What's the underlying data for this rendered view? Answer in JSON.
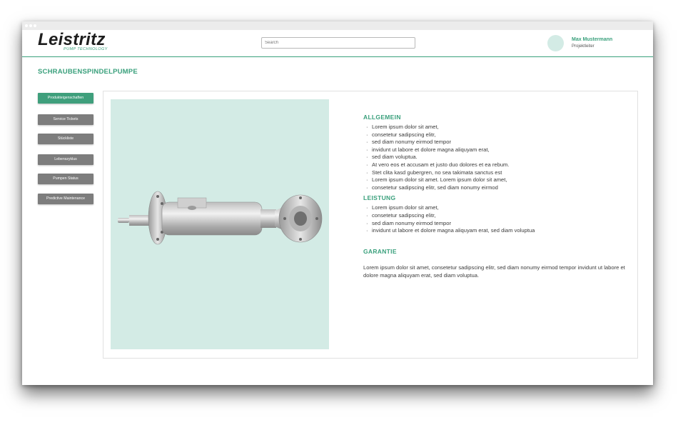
{
  "brand": {
    "name": "Leistritz",
    "tagline": "PUMP TECHNOLOGY",
    "accent": "#3aa07c",
    "image_bg": "#d3ebe5"
  },
  "search": {
    "placeholder": "Search"
  },
  "user": {
    "name": "Max Mustermann",
    "role": "Projektleiter"
  },
  "page": {
    "title": "SCHRAUBENSPINDELPUMPE"
  },
  "nav": {
    "items": [
      {
        "label": "Produkteigenschaften",
        "active": true
      },
      {
        "label": "Service Tickets",
        "active": false
      },
      {
        "label": "Stückliste",
        "active": false
      },
      {
        "label": "Lebenszyklus",
        "active": false
      },
      {
        "label": "Pumpen Status",
        "active": false
      },
      {
        "label": "Predictive Maintenance",
        "active": false
      }
    ]
  },
  "product": {
    "image_icon": "screw-spindle-pump-image"
  },
  "sections": {
    "allgemein": {
      "title": "ALLGEMEIN",
      "items": [
        "Lorem ipsum dolor sit amet,",
        "consetetur sadipscing elitr,",
        "sed diam nonumy eirmod tempor",
        "invidunt ut labore et dolore magna aliquyam erat,",
        "sed diam voluptua.",
        "At vero eos et accusam et justo duo dolores et ea rebum.",
        "Stet clita kasd gubergren, no sea takimata sanctus est",
        "Lorem ipsum dolor sit amet. Lorem ipsum dolor sit amet,",
        "consetetur sadipscing elitr, sed diam nonumy eirmod"
      ]
    },
    "leistung": {
      "title": "LEISTUNG",
      "items": [
        "Lorem ipsum dolor sit amet,",
        "consetetur sadipscing elitr,",
        "sed diam nonumy eirmod tempor",
        "invidunt ut labore et dolore magna aliquyam erat, sed diam voluptua"
      ]
    },
    "garantie": {
      "title": "GARANTIE",
      "text": "Lorem ipsum dolor sit amet, consetetur sadipscing elitr, sed diam nonumy eirmod tempor invidunt ut labore et dolore magna aliquyam erat, sed diam voluptua."
    }
  }
}
